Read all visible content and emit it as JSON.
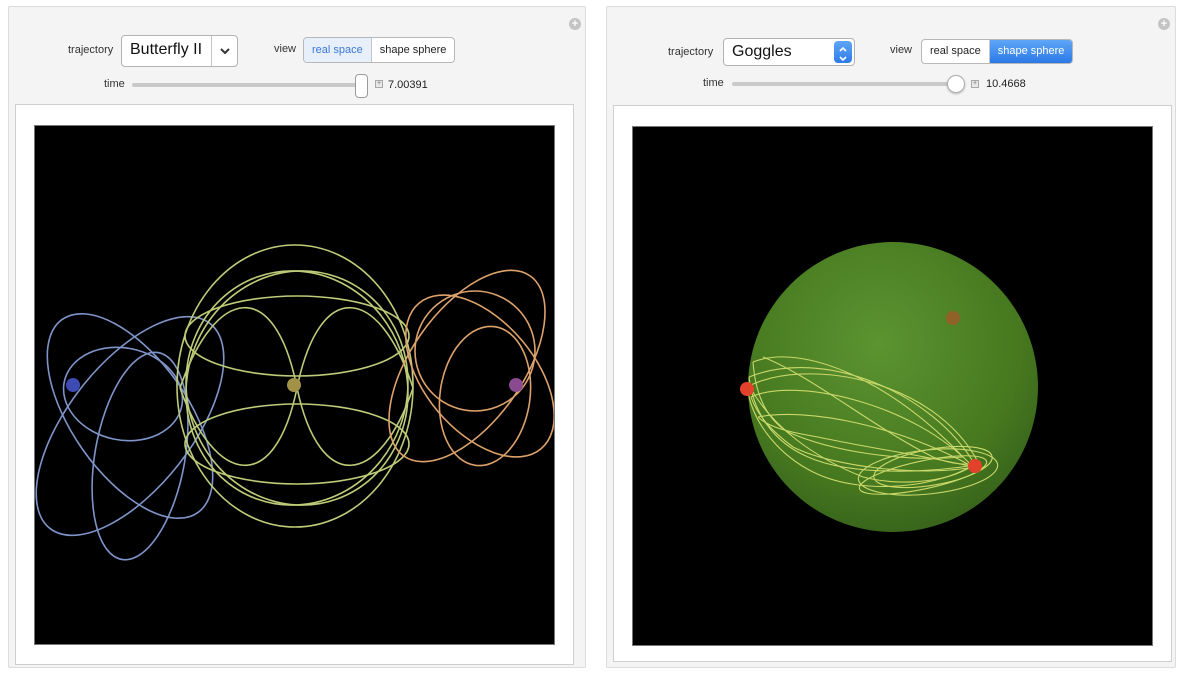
{
  "left": {
    "trajectory_label": "trajectory",
    "trajectory_value": "Butterfly II",
    "view_label": "view",
    "view_options": [
      "real space",
      "shape sphere"
    ],
    "view_selected": "real space",
    "time_label": "time",
    "time_value": "7.00391",
    "time_fraction": 0.99
  },
  "right": {
    "trajectory_label": "trajectory",
    "trajectory_value": "Goggles",
    "view_label": "view",
    "view_options": [
      "real space",
      "shape sphere"
    ],
    "view_selected": "shape sphere",
    "time_label": "time",
    "time_value": "10.4668",
    "time_fraction": 0.98
  },
  "colors": {
    "blue_orbit": "#7f94c9",
    "green_orbit": "#bdcc78",
    "orange_orbit": "#dda26c",
    "sphere": "#4a7d24",
    "mass_red": "#e2412a",
    "mass_blue": "#3f4bb5",
    "mass_olive": "#a29246",
    "mass_purple": "#8a4a8f"
  }
}
